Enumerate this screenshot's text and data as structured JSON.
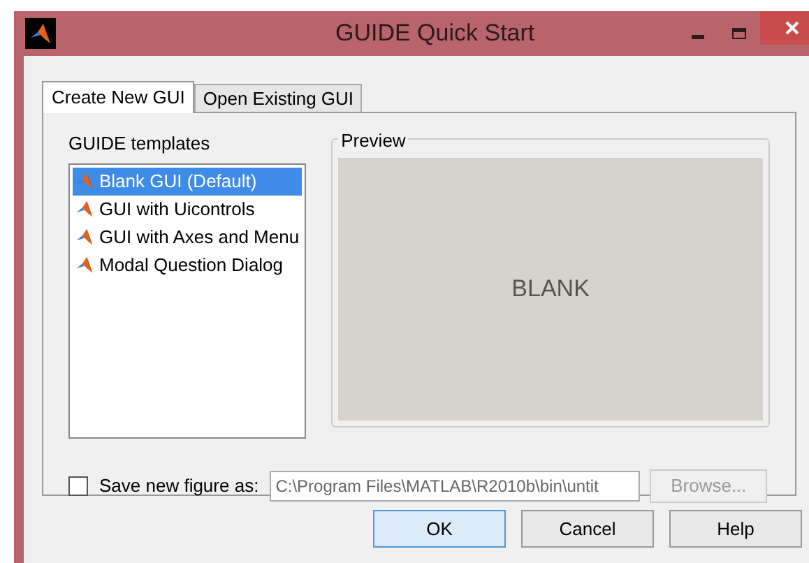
{
  "window": {
    "title": "GUIDE Quick Start"
  },
  "tabs": [
    {
      "label": "Create New GUI",
      "selected": true
    },
    {
      "label": "Open Existing GUI",
      "selected": false
    }
  ],
  "templates": {
    "label": "GUIDE templates",
    "items": [
      {
        "label": "Blank GUI (Default)",
        "selected": true
      },
      {
        "label": "GUI with Uicontrols",
        "selected": false
      },
      {
        "label": "GUI with Axes and Menu",
        "selected": false
      },
      {
        "label": "Modal Question Dialog",
        "selected": false
      }
    ]
  },
  "preview": {
    "label": "Preview",
    "text": "BLANK"
  },
  "save_figure": {
    "label": "Save new figure as:",
    "checked": false,
    "value": "C:\\Program Files\\MATLAB\\R2010b\\bin\\untit",
    "browse": "Browse...",
    "browse_disabled": true
  },
  "buttons": [
    {
      "label": "OK",
      "default": true
    },
    {
      "label": "Cancel",
      "default": false
    },
    {
      "label": "Help",
      "default": false
    }
  ]
}
